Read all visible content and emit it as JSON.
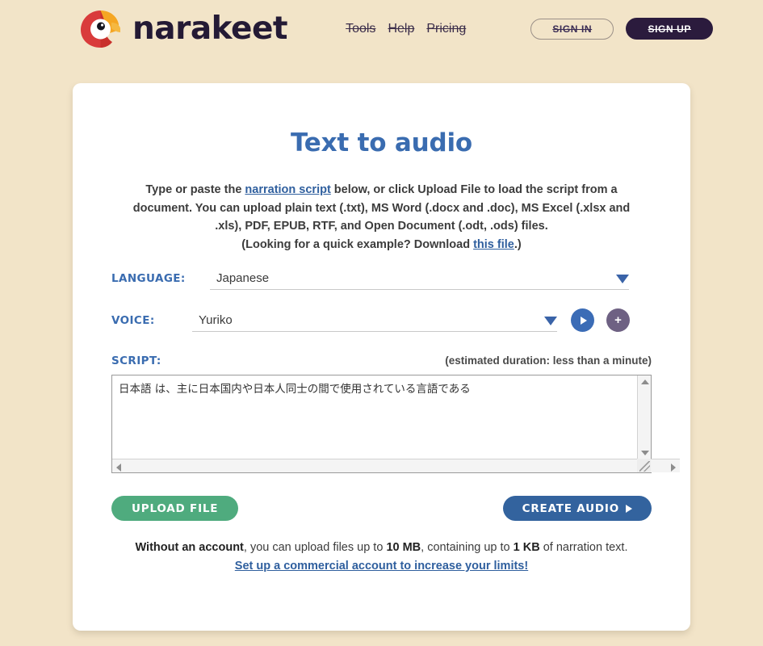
{
  "brand": {
    "name": "narakeet",
    "logo_icon": "parrot-logo-icon"
  },
  "nav": {
    "items": [
      {
        "label": "Tools"
      },
      {
        "label": "Help"
      },
      {
        "label": "Pricing"
      }
    ],
    "sign_in": "SIGN IN",
    "sign_up": "SIGN UP"
  },
  "main": {
    "title": "Text to audio",
    "intro": {
      "part1": "Type or paste the ",
      "link1": "narration script",
      "part2": " below, or click ",
      "bold1": "Upload File",
      "part3": " to load the script from a document. You can upload plain text (.txt), MS Word (.docx and .doc), MS Excel (.xlsx and .xls), PDF, EPUB, RTF, and Open Document (.odt, .ods) files.",
      "part4": "(Looking for a quick example? Download ",
      "link2": "this file",
      "part5": ".)"
    },
    "language": {
      "label": "LANGUAGE:",
      "value": "Japanese",
      "caret_icon": "chevron-down-icon"
    },
    "voice": {
      "label": "VOICE:",
      "value": "Yuriko",
      "caret_icon": "chevron-down-icon",
      "play_icon": "play-icon",
      "add_icon": "plus-icon"
    },
    "script": {
      "label": "SCRIPT:",
      "duration": "(estimated duration: less than a minute)",
      "value": "日本語 は、主に日本国内や日本人同士の間で使用されている言語である"
    },
    "upload_button": "UPLOAD FILE",
    "create_button": "CREATE AUDIO",
    "create_button_icon": "play-icon"
  },
  "footer": {
    "bold_lead": "Without an account",
    "text1": ", you can upload files up to ",
    "size": "10 MB",
    "text2": ", containing up to ",
    "chars": "1 KB",
    "text3": " of narration text.",
    "limit_link": "Set up a commercial account to increase your limits!"
  },
  "colors": {
    "page_bg": "#f2e4c8",
    "card_bg": "#ffffff",
    "title_blue": "#3a6cb0",
    "label_blue": "#3a6cb0",
    "brand_dark": "#241a35",
    "signup_bg": "#2b1b3d",
    "upload_green": "#4fab7e",
    "create_blue": "#33639e",
    "play_blue": "#3b6cb6",
    "add_purple": "#6e6183",
    "logo_red": "#d93b3b",
    "logo_orange": "#f5a623"
  }
}
